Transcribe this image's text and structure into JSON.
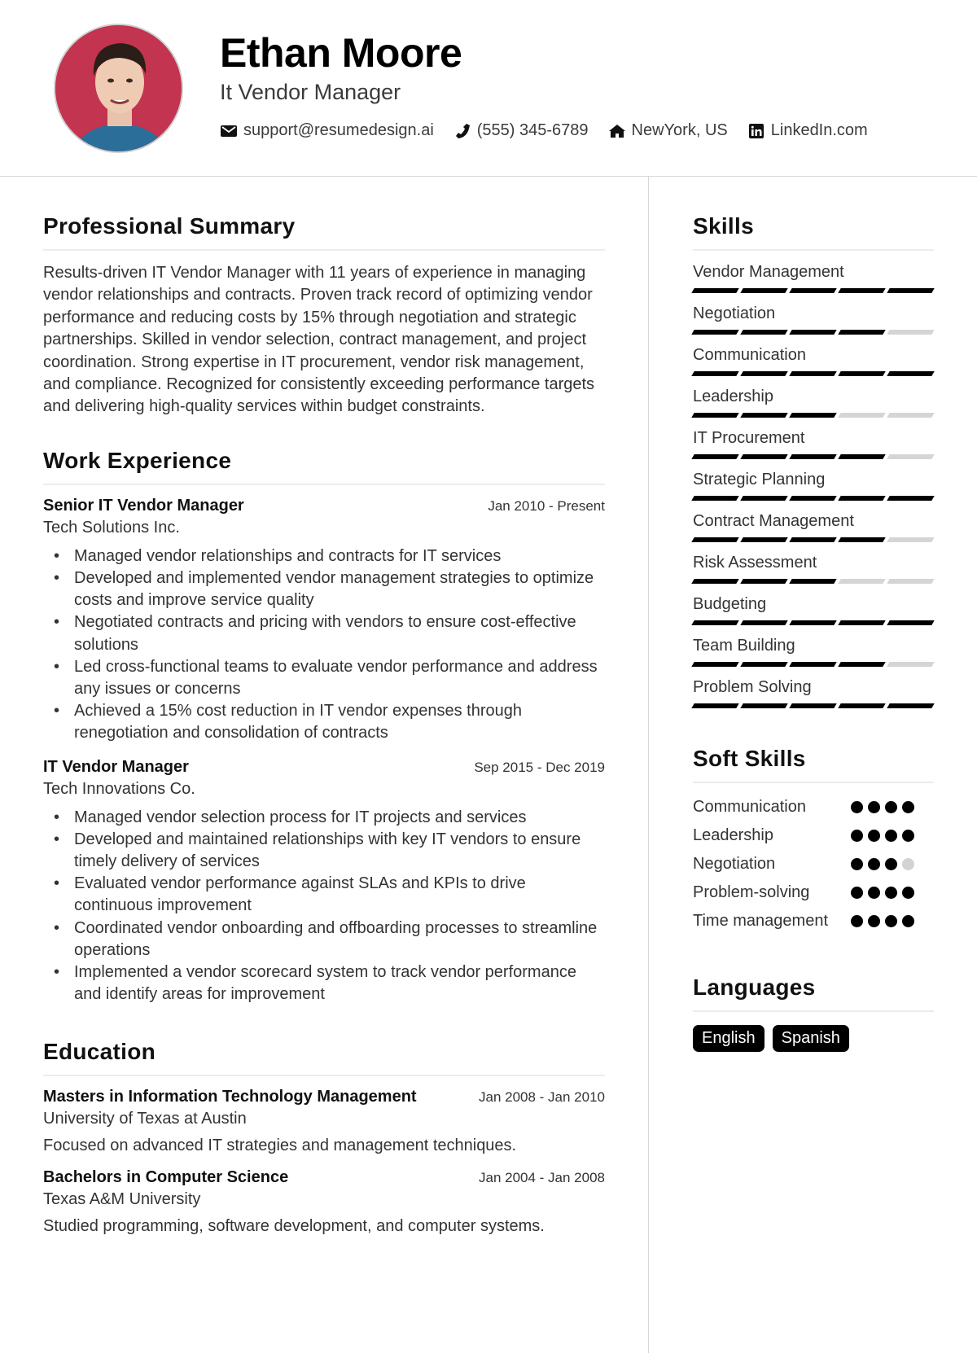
{
  "header": {
    "name": "Ethan Moore",
    "title": "It Vendor Manager",
    "contacts": [
      {
        "icon": "envelope-icon",
        "text": "support@resumedesign.ai"
      },
      {
        "icon": "phone-icon",
        "text": "(555) 345-6789"
      },
      {
        "icon": "home-icon",
        "text": "NewYork, US"
      },
      {
        "icon": "linkedin-icon",
        "text": "LinkedIn.com"
      }
    ]
  },
  "summary": {
    "heading": "Professional Summary",
    "text": "Results-driven IT Vendor Manager with 11 years of experience in managing vendor relationships and contracts. Proven track record of optimizing vendor performance and reducing costs by 15% through negotiation and strategic partnerships. Skilled in vendor selection, contract management, and project coordination. Strong expertise in IT procurement, vendor risk management, and compliance. Recognized for consistently exceeding performance targets and delivering high-quality services within budget constraints."
  },
  "experience": {
    "heading": "Work Experience",
    "jobs": [
      {
        "role": "Senior IT Vendor Manager",
        "date": "Jan 2010 - Present",
        "company": "Tech Solutions Inc.",
        "bullets": [
          "Managed vendor relationships and contracts for IT services",
          "Developed and implemented vendor management strategies to optimize costs and improve service quality",
          "Negotiated contracts and pricing with vendors to ensure cost-effective solutions",
          "Led cross-functional teams to evaluate vendor performance and address any issues or concerns",
          "Achieved a 15% cost reduction in IT vendor expenses through renegotiation and consolidation of contracts"
        ]
      },
      {
        "role": "IT Vendor Manager",
        "date": "Sep 2015 - Dec 2019",
        "company": "Tech Innovations Co.",
        "bullets": [
          "Managed vendor selection process for IT projects and services",
          "Developed and maintained relationships with key IT vendors to ensure timely delivery of services",
          "Evaluated vendor performance against SLAs and KPIs to drive continuous improvement",
          "Coordinated vendor onboarding and offboarding processes to streamline operations",
          "Implemented a vendor scorecard system to track vendor performance and identify areas for improvement"
        ]
      }
    ]
  },
  "education": {
    "heading": "Education",
    "items": [
      {
        "degree": "Masters in Information Technology Management",
        "date": "Jan 2008 - Jan 2010",
        "school": "University of Texas at Austin",
        "desc": "Focused on advanced IT strategies and management techniques."
      },
      {
        "degree": "Bachelors in Computer Science",
        "date": "Jan 2004 - Jan 2008",
        "school": "Texas A&M University",
        "desc": "Studied programming, software development, and computer systems."
      }
    ]
  },
  "skills": {
    "heading": "Skills",
    "max": 5,
    "items": [
      {
        "name": "Vendor Management",
        "level": 5
      },
      {
        "name": "Negotiation",
        "level": 4
      },
      {
        "name": "Communication",
        "level": 5
      },
      {
        "name": "Leadership",
        "level": 3
      },
      {
        "name": "IT Procurement",
        "level": 4
      },
      {
        "name": "Strategic Planning",
        "level": 5
      },
      {
        "name": "Contract Management",
        "level": 4
      },
      {
        "name": "Risk Assessment",
        "level": 3
      },
      {
        "name": "Budgeting",
        "level": 5
      },
      {
        "name": "Team Building",
        "level": 4
      },
      {
        "name": "Problem Solving",
        "level": 5
      }
    ]
  },
  "soft_skills": {
    "heading": "Soft Skills",
    "max": 4,
    "items": [
      {
        "name": "Communication",
        "level": 4
      },
      {
        "name": "Leadership",
        "level": 4
      },
      {
        "name": "Negotiation",
        "level": 3
      },
      {
        "name": "Problem-solving",
        "level": 4
      },
      {
        "name": "Time management",
        "level": 4
      }
    ]
  },
  "languages": {
    "heading": "Languages",
    "items": [
      "English",
      "Spanish"
    ]
  }
}
